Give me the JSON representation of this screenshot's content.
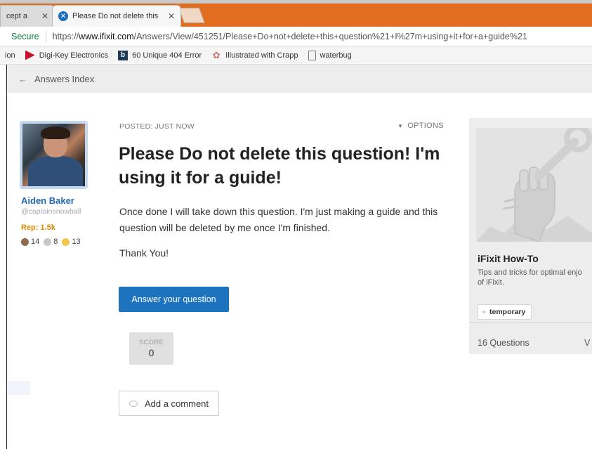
{
  "browser": {
    "tabs": [
      {
        "label": "cept a"
      },
      {
        "label": "Please Do not delete this"
      }
    ],
    "address": {
      "secure_label": "Secure",
      "url_prefix": "https://",
      "url_host": "www.ifixit.com",
      "url_path": "/Answers/View/451251/Please+Do+not+delete+this+question%21+I%27m+using+it+for+a+guide%21"
    },
    "bookmarks": [
      {
        "label": "ion"
      },
      {
        "label": "Digi-Key Electronics"
      },
      {
        "label": "60 Unique 404 Error"
      },
      {
        "label": "Illustrated with Crapp"
      },
      {
        "label": "waterbug"
      }
    ]
  },
  "breadcrumb": {
    "label": "Answers Index"
  },
  "author": {
    "name": "Aiden Baker",
    "handle": "@captainsnowball",
    "rep": "Rep: 1.5k",
    "badges": [
      {
        "count": "14",
        "color": "#8c6d4f"
      },
      {
        "count": "8",
        "color": "#c8c8c8"
      },
      {
        "count": "13",
        "color": "#f2c74e"
      }
    ]
  },
  "post": {
    "posted": "POSTED: JUST NOW",
    "options": "OPTIONS",
    "title": "Please Do not delete this question! I'm using it for a guide!",
    "body": "Once done I will take down this question. I'm just making a guide and this question will be deleted by me once I'm finished.",
    "thanks": "Thank You!",
    "answer_button": "Answer your question",
    "score_label": "SCORE",
    "score_value": "0",
    "comment_button": "Add a comment"
  },
  "side_card": {
    "title": "iFixit How-To",
    "desc_line1": "Tips and tricks for optimal enjo",
    "desc_line2": "of iFixit.",
    "tag": "temporary",
    "count": "16 Questions",
    "extra": "V"
  },
  "colors": {
    "tab_strip": "#e26d1e",
    "link_blue": "#1f69b3",
    "primary_button": "#1e73be",
    "rep_orange": "#e08b00",
    "secure_green": "#0b8043"
  }
}
